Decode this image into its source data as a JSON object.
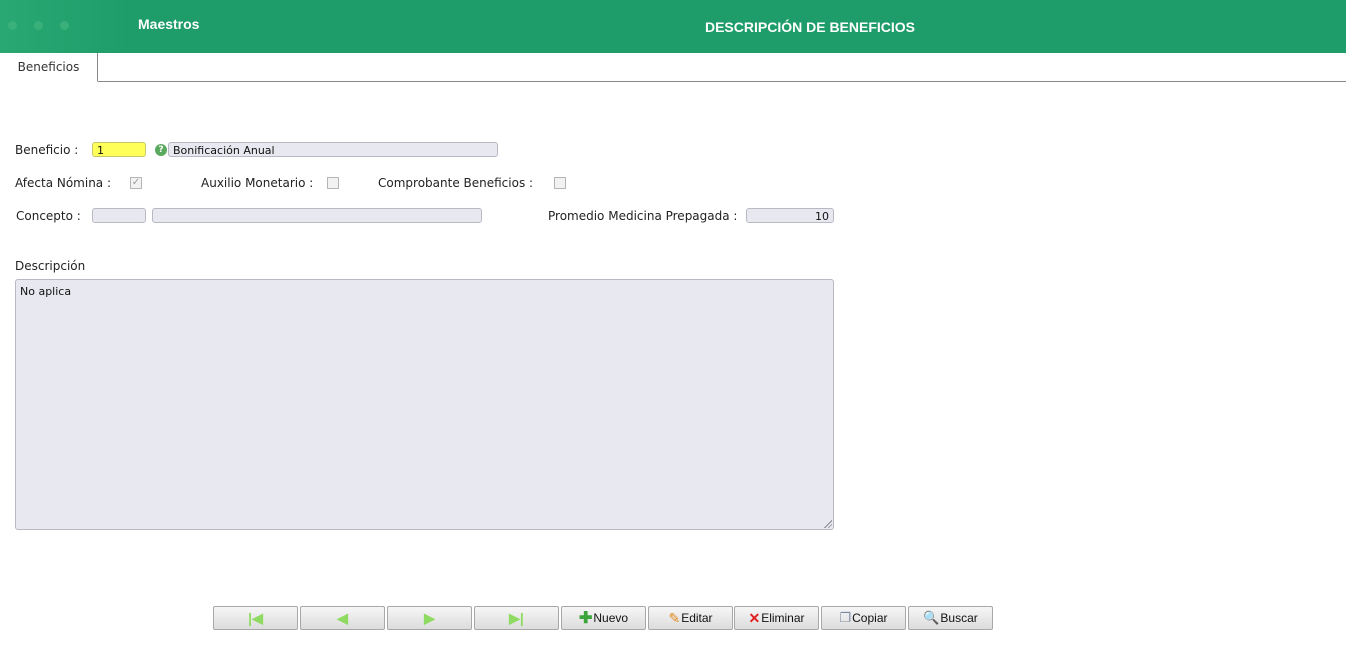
{
  "header": {
    "app_title": "Maestros",
    "page_title": "DESCRIPCIÓN DE BENEFICIOS"
  },
  "tabs": [
    {
      "label": "Beneficios",
      "active": true
    }
  ],
  "form": {
    "beneficio_label": "Beneficio :",
    "beneficio_code": "1",
    "beneficio_name": "Bonificación Anual",
    "afecta_nomina_label": "Afecta Nómina :",
    "afecta_nomina_checked": true,
    "auxilio_monetario_label": "Auxilio Monetario :",
    "auxilio_monetario_checked": false,
    "comprobante_beneficios_label": "Comprobante Beneficios :",
    "comprobante_beneficios_checked": false,
    "concepto_label": "Concepto :",
    "concepto_code": "",
    "concepto_name": "",
    "promedio_label": "Promedio Medicina Prepagada :",
    "promedio_value": "10",
    "descripcion_label": "Descripción",
    "descripcion_value": "No aplica"
  },
  "toolbar": {
    "first_icon": "first-record-icon",
    "prev_icon": "previous-record-icon",
    "next_icon": "next-record-icon",
    "last_icon": "last-record-icon",
    "nuevo": "Nuevo",
    "editar": "Editar",
    "eliminar": "Eliminar",
    "copiar": "Copiar",
    "buscar": "Buscar"
  },
  "colors": {
    "header_bg": "#1e9c6a",
    "required_field": "#ffff5a",
    "field_bg": "#e8e8f0"
  }
}
